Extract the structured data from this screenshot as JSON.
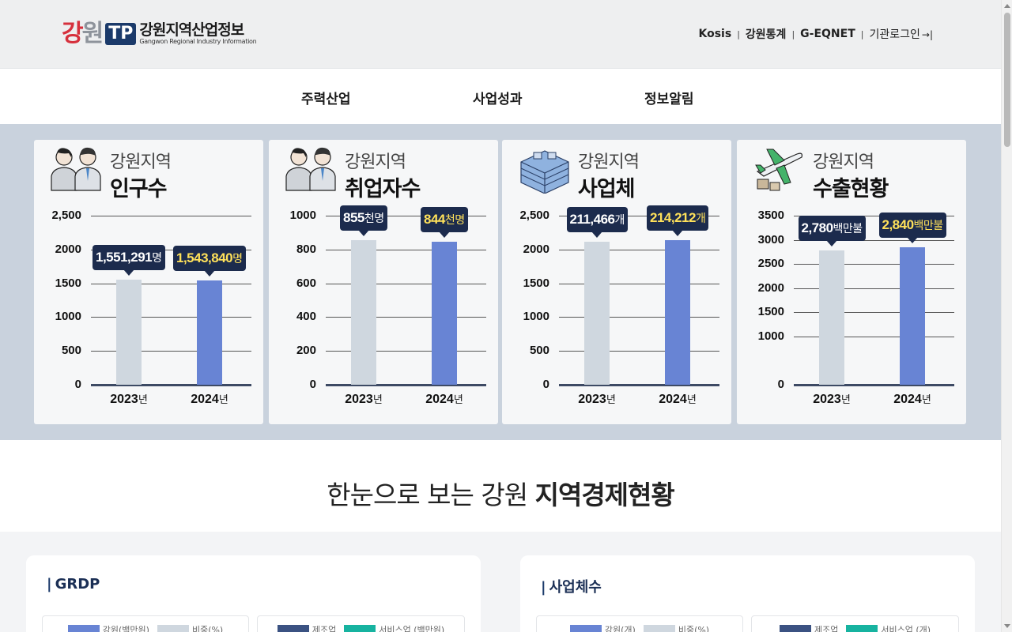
{
  "logo": {
    "kw_part1": "강",
    "kw_part2": "원",
    "tp": "TP",
    "korean": "강원지역산업정보",
    "english": "Gangwon Regional Industry Information"
  },
  "utils": {
    "items": [
      "Kosis",
      "강원통계",
      "G-EQNET"
    ],
    "login": "기관로그인",
    "login_icon": "→|"
  },
  "nav": {
    "items": [
      "주력산업",
      "사업성과",
      "정보알림"
    ]
  },
  "colors": {
    "bar_prev": "#cfd7df",
    "bar_curr": "#6884d4",
    "callout_bg": "#1c2b4d",
    "highlight": "#ffe15a",
    "band": "#c9d2dd"
  },
  "cards": [
    {
      "icon": "people-icon",
      "subtitle": "강원지역",
      "title": "인구수",
      "x_suffix": "년",
      "chart_data": {
        "type": "bar",
        "categories": [
          "2023",
          "2024"
        ],
        "values": [
          1551291,
          1543840
        ],
        "ylim": [
          0,
          2500
        ],
        "yticks": [
          "0",
          "500",
          "1000",
          "1500",
          "2000",
          "2,500"
        ],
        "scale": 1000
      },
      "labels": [
        {
          "num": "1,551,291",
          "unit": "명"
        },
        {
          "num": "1,543,840",
          "unit": "명"
        }
      ]
    },
    {
      "icon": "people-icon",
      "subtitle": "강원지역",
      "title": "취업자수",
      "x_suffix": "년",
      "chart_data": {
        "type": "bar",
        "categories": [
          "2023",
          "2024"
        ],
        "values": [
          855,
          844
        ],
        "ylim": [
          0,
          1000
        ],
        "yticks": [
          "0",
          "200",
          "400",
          "600",
          "800",
          "1000"
        ],
        "scale": 1
      },
      "labels": [
        {
          "num": "855",
          "unit": "천명"
        },
        {
          "num": "844",
          "unit": "천명"
        }
      ]
    },
    {
      "icon": "building-icon",
      "subtitle": "강원지역",
      "title": "사업체",
      "x_suffix": "년",
      "chart_data": {
        "type": "bar",
        "categories": [
          "2023",
          "2024"
        ],
        "values": [
          211466,
          214212
        ],
        "ylim": [
          0,
          2500
        ],
        "yticks": [
          "0",
          "500",
          "1000",
          "1500",
          "2000",
          "2,500"
        ],
        "scale": 100
      },
      "labels": [
        {
          "num": "211,466",
          "unit": "개"
        },
        {
          "num": "214,212",
          "unit": "개"
        }
      ]
    },
    {
      "icon": "airplane-icon",
      "subtitle": "강원지역",
      "title": "수출현황",
      "x_suffix": "년",
      "chart_data": {
        "type": "bar",
        "categories": [
          "2023",
          "2024"
        ],
        "values": [
          2780,
          2840
        ],
        "ylim": [
          0,
          3500
        ],
        "yticks": [
          "0",
          "1000",
          "1500",
          "2000",
          "2500",
          "3000",
          "3500"
        ],
        "scale": 1
      },
      "labels": [
        {
          "num": "2,780",
          "unit": "백만불"
        },
        {
          "num": "2,840",
          "unit": "백만불"
        }
      ]
    }
  ],
  "section": {
    "title_light": "한눈으로 보는 강원 ",
    "title_bold": "지역경제현황"
  },
  "panels": [
    {
      "title": "GRDP",
      "legend_left": [
        {
          "label": "강원(백만원)",
          "color": "#6884d4"
        },
        {
          "label": "비중(%)",
          "color": "#cfd7df"
        }
      ],
      "legend_right": [
        {
          "label": "제조업",
          "color": "#3b5282"
        },
        {
          "label": "서비스업 (백만원)",
          "color": "#17b3a0"
        }
      ]
    },
    {
      "title": "사업체수",
      "legend_left": [
        {
          "label": "강원(개)",
          "color": "#6884d4"
        },
        {
          "label": "비중(%)",
          "color": "#cfd7df"
        }
      ],
      "legend_right": [
        {
          "label": "제조업",
          "color": "#3b5282"
        },
        {
          "label": "서비스업 (개)",
          "color": "#17b3a0"
        }
      ]
    }
  ]
}
